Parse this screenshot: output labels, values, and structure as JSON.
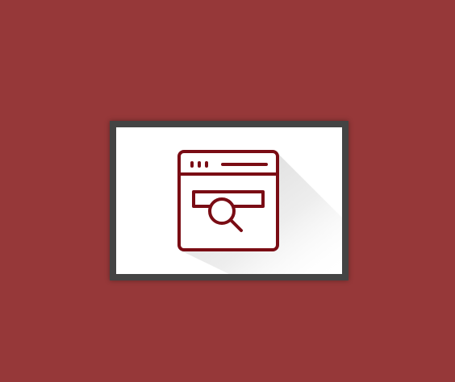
{
  "colors": {
    "background": "#963839",
    "frame_border": "#444444",
    "frame_fill": "#ffffff",
    "icon_stroke": "#7a0c14",
    "long_shadow": "#d6d6d6"
  },
  "icon": {
    "name": "browser-search-icon",
    "description_hidden": ""
  }
}
